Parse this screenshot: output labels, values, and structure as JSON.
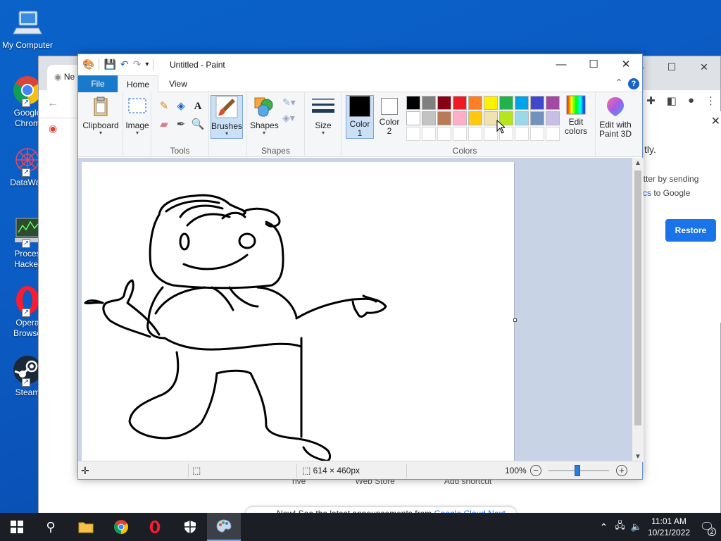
{
  "desktop": {
    "icons": [
      {
        "label": "My Computer"
      },
      {
        "label": "Google\nChrom"
      },
      {
        "label": "DataWag"
      },
      {
        "label": "Proces\nHacker"
      },
      {
        "label": "Opera\nBrowse"
      },
      {
        "label": "Steam"
      }
    ]
  },
  "chrome": {
    "tab_text": "Ne",
    "panel_text1": "tly.",
    "panel_text2a": "etter by sending",
    "panel_text2b": "tics",
    "panel_text2c": " to Google",
    "restore_label": "Restore",
    "bottom_links": [
      "rive",
      "Web Store",
      "Add shortcut"
    ],
    "notice_prefix": "New! See the latest announcements from ",
    "notice_highlight": "Google Cloud Next"
  },
  "paint": {
    "title": "Untitled - Paint",
    "tabs": {
      "file": "File",
      "home": "Home",
      "view": "View"
    },
    "groups": {
      "clipboard": "Clipboard",
      "image": "Image",
      "tools": "Tools",
      "brushes": "Brushes",
      "shapes_btn": "Shapes",
      "shapes": "Shapes",
      "size": "Size",
      "color1": "Color 1",
      "color1_b": "1",
      "color2": "Color",
      "color2_b": "2",
      "colors": "Colors",
      "edit_colors_a": "Edit",
      "edit_colors_b": "colors",
      "edit3d_a": "Edit with",
      "edit3d_b": "Paint 3D"
    },
    "palette_row1": [
      "#000000",
      "#7f7f7f",
      "#880015",
      "#ed1c24",
      "#ff7f27",
      "#fff200",
      "#22b14c",
      "#00a2e8",
      "#3f48cc",
      "#a349a4"
    ],
    "palette_row2": [
      "#ffffff",
      "#c3c3c3",
      "#b97a57",
      "#ffaec9",
      "#ffc90e",
      "#efe4b0",
      "#b5e61d",
      "#99d9ea",
      "#7092be",
      "#c8bfe7"
    ],
    "color1_value": "#000000",
    "color2_value": "#ffffff",
    "status": {
      "dimensions": "614 × 460px",
      "zoom": "100%"
    }
  },
  "taskbar": {
    "time": "11:01 AM",
    "date": "10/21/2022",
    "notification_count": "2"
  }
}
